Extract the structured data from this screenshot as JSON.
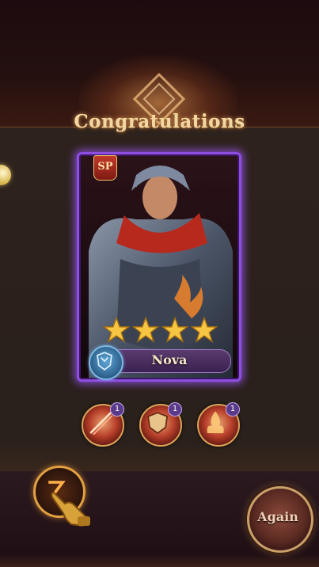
{
  "header": {
    "title": "Congratulations"
  },
  "hero": {
    "rarity_badge": "SP",
    "name": "Nova",
    "star_count": 4,
    "portrait_icon": "armored-knight-portrait"
  },
  "skills": [
    {
      "icon": "slash-skill-icon",
      "level": "1"
    },
    {
      "icon": "shield-skill-icon",
      "level": "1"
    },
    {
      "icon": "flame-warrior-skill-icon",
      "level": "1"
    }
  ],
  "controls": {
    "again_label": "Again",
    "hand_icon": "pointing-hand-icon"
  },
  "colors": {
    "card_border": "#8e4fe0",
    "title": "#f2d7a3",
    "star": "#f6c643"
  }
}
